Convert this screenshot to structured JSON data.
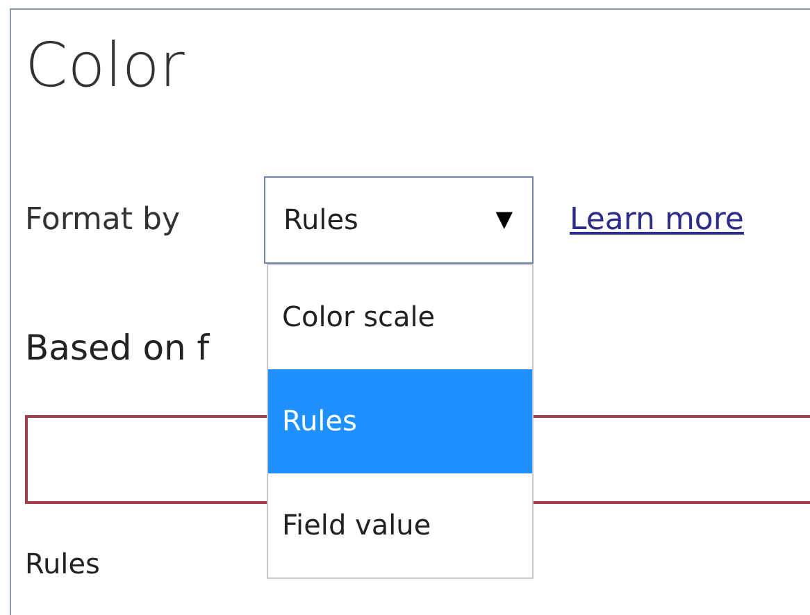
{
  "title": "Color",
  "format_by": {
    "label": "Format by",
    "value": "Rules",
    "arrow": "▼",
    "expanded": true,
    "options": [
      {
        "label": "Color scale",
        "selected": false
      },
      {
        "label": "Rules",
        "selected": true
      },
      {
        "label": "Field value",
        "selected": false
      }
    ]
  },
  "learn_more": "Learn more",
  "based_on_label": "Based on f",
  "based_on_field": {
    "invalid": true
  },
  "rules_label": "Rules"
}
